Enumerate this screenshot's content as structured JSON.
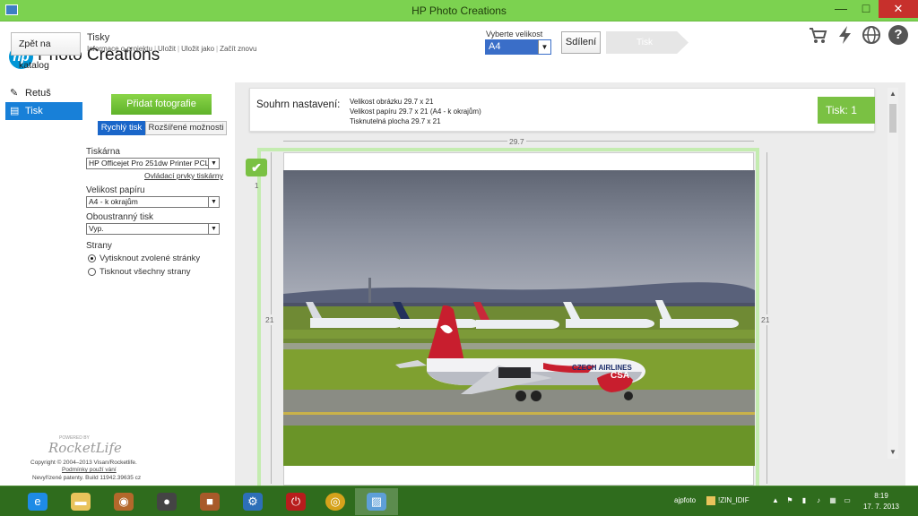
{
  "window": {
    "title": "HP Photo Creations",
    "minimize": "—",
    "maximize": "□",
    "close": "✕"
  },
  "header": {
    "brand": "Photo Creations",
    "logo": "hp",
    "back_label": "Zpět na katalog",
    "project_title": "Tisky",
    "project_links": [
      "Informace o projektu",
      "Uložit",
      "Uložit jako",
      "Začít znovu"
    ],
    "size_label": "Vyberte velikost",
    "size_value": "A4",
    "share_label": "Sdílení",
    "print_label": "Tisk",
    "icons": [
      "cart-icon",
      "bolt-icon",
      "globe-icon",
      "help-icon"
    ]
  },
  "nav": {
    "items": [
      {
        "label": "Retuš",
        "icon": "brush-icon"
      },
      {
        "label": "Tisk",
        "icon": "printer-icon"
      }
    ]
  },
  "settings": {
    "add_photos": "Přidat fotografie",
    "tabs": [
      "Rychlý tisk",
      "Rozšířené možnosti"
    ],
    "printer_label": "Tiskárna",
    "printer_value": "HP Officejet Pro 251dw Printer PCL 6",
    "printer_link": "Ovládací prvky tiskárny",
    "paper_label": "Velikost papíru",
    "paper_value": "A4 - k okrajům",
    "duplex_label": "Oboustranný tisk",
    "duplex_value": "Vyp.",
    "pages_label": "Strany",
    "pages_options": [
      "Vytisknout zvolené stránky",
      "Tisknout všechny strany"
    ]
  },
  "footer": {
    "powered_by": "POWERED BY",
    "powered_brand": "RocketLife",
    "copyright": "Copyright © 2004–2013 Visan/Rocketlife.",
    "terms": "Podmínky použí vání",
    "patents": "Nevyřízené patenty.  Build 11942.39635 cz"
  },
  "summary": {
    "label": "Souhrn nastavení:",
    "lines": [
      "Velikost obrázku 29.7 x 21",
      "Velikost papíru 29.7 x 21 (A4 - k okrajům)",
      "Tisknutelná plocha 29.7 x 21"
    ],
    "print_count": "Tisk: 1"
  },
  "preview": {
    "width_label": "29.7",
    "height_label": "21",
    "page_marker": "1",
    "airline_text": "CZECH AIRLINES",
    "tail_text": "CSA"
  },
  "taskbar": {
    "tray_user": "ajpfoto",
    "tray_folder": "!ZIN_IDIF",
    "time": "8:19",
    "date": "17. 7. 2013"
  }
}
